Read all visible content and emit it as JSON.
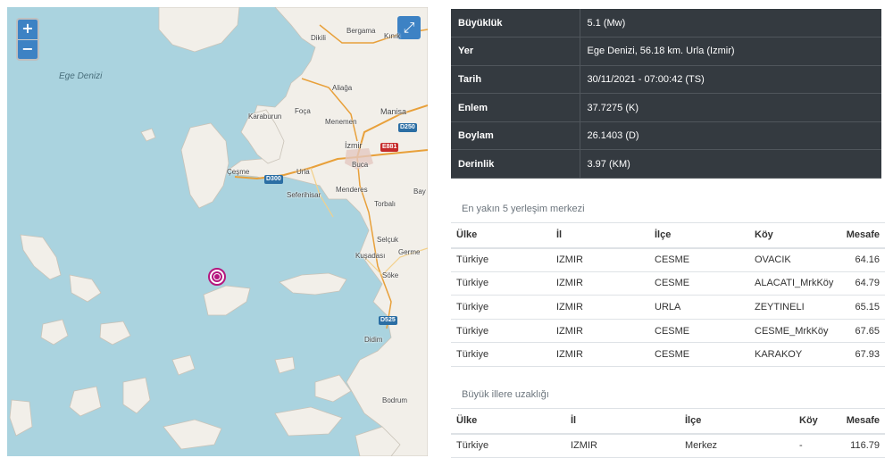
{
  "map": {
    "zoom_in": "+",
    "zoom_out": "−",
    "fullscreen": "⤢",
    "sea_label": "Ege Denizi",
    "places": {
      "dikili": "Dikili",
      "bergama": "Bergama",
      "kinik": "Kınık",
      "aliaga": "Aliağa",
      "karaburun": "Karaburun",
      "foca": "Foça",
      "menemen": "Menemen",
      "manisa": "Manisa",
      "izmir": "İzmir",
      "buca": "Buca",
      "cesme": "Çeşme",
      "urla": "Urla",
      "seferihisar": "Seferihisar",
      "menderes": "Menderes",
      "torbali": "Torbalı",
      "bay": "Bay",
      "selcuk": "Selçuk",
      "kusadasi": "Kuşadası",
      "germe": "Germe",
      "soke": "Söke",
      "didim": "Didim",
      "bodrum": "Bodrum"
    },
    "roads": {
      "d250": "D250",
      "e881": "E881",
      "d300": "D300",
      "d525": "D525"
    }
  },
  "info": {
    "rows": [
      {
        "key": "Büyüklük",
        "value": "5.1 (Mw)"
      },
      {
        "key": "Yer",
        "value": "Ege Denizi, 56.18 km. Urla (Izmir)"
      },
      {
        "key": "Tarih",
        "value": "30/11/2021 - 07:00:42 (TS)"
      },
      {
        "key": "Enlem",
        "value": "37.7275 (K)"
      },
      {
        "key": "Boylam",
        "value": "26.1403 (D)"
      },
      {
        "key": "Derinlik",
        "value": "3.97 (KM)"
      }
    ]
  },
  "nearest": {
    "title": "En yakın 5 yerleşim merkezi",
    "headers": {
      "country": "Ülke",
      "province": "İl",
      "district": "İlçe",
      "village": "Köy",
      "distance": "Mesafe"
    },
    "rows": [
      {
        "country": "Türkiye",
        "province": "IZMIR",
        "district": "CESME",
        "village": "OVACIK",
        "distance": "64.16"
      },
      {
        "country": "Türkiye",
        "province": "IZMIR",
        "district": "CESME",
        "village": "ALACATI_MrkKöy",
        "distance": "64.79"
      },
      {
        "country": "Türkiye",
        "province": "IZMIR",
        "district": "URLA",
        "village": "ZEYTINELI",
        "distance": "65.15"
      },
      {
        "country": "Türkiye",
        "province": "IZMIR",
        "district": "CESME",
        "village": "CESME_MrkKöy",
        "distance": "67.65"
      },
      {
        "country": "Türkiye",
        "province": "IZMIR",
        "district": "CESME",
        "village": "KARAKOY",
        "distance": "67.93"
      }
    ]
  },
  "cities": {
    "title": "Büyük illere uzaklığı",
    "headers": {
      "country": "Ülke",
      "province": "İl",
      "district": "İlçe",
      "village": "Köy",
      "distance": "Mesafe"
    },
    "rows": [
      {
        "country": "Türkiye",
        "province": "IZMIR",
        "district": "Merkez",
        "village": "-",
        "distance": "116.79"
      }
    ]
  }
}
